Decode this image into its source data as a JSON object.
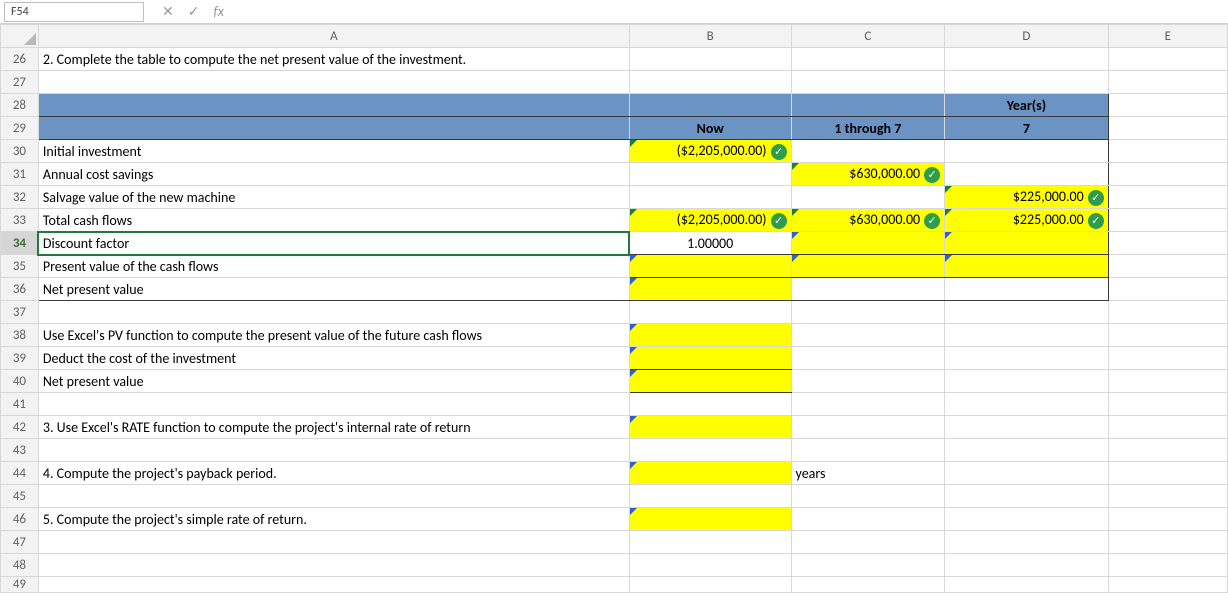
{
  "namebox": "F54",
  "icons": {
    "cancel": "✕",
    "enter": "✓",
    "fx": "fx"
  },
  "cols": {
    "A": "A",
    "B": "B",
    "C": "C",
    "D": "D",
    "E": "E"
  },
  "rows": {
    "r26": "26",
    "r27": "27",
    "r28": "28",
    "r29": "29",
    "r30": "30",
    "r31": "31",
    "r32": "32",
    "r33": "33",
    "r34": "34",
    "r35": "35",
    "r36": "36",
    "r37": "37",
    "r38": "38",
    "r39": "39",
    "r40": "40",
    "r41": "41",
    "r42": "42",
    "r43": "43",
    "r44": "44",
    "r45": "45",
    "r46": "46",
    "r47": "47",
    "r48": "48",
    "r49": "49"
  },
  "hdr": {
    "years": "Year(s)",
    "now": "Now",
    "oneThrough7": "1 through 7",
    "seven": "7"
  },
  "labels": {
    "q2": "2. Complete the table to compute the net present value of the investment.",
    "initInv": "Initial investment",
    "annSave": "Annual cost savings",
    "salvage": "Salvage value of the new machine",
    "totalCF": "Total cash flows",
    "disc": "Discount factor",
    "pvCF": "Present value of the cash flows",
    "npv": "Net present value",
    "pvFunc": "Use Excel's PV function to compute the present value of the future cash flows",
    "deduct": "Deduct the cost of the investment",
    "npv2": "Net present value",
    "q3": "3. Use Excel's RATE function to compute the project's internal rate of return",
    "q4": "4. Compute the project's payback period.",
    "years": "years",
    "q5": "5. Compute the project's simple rate of return."
  },
  "vals": {
    "B30": "($2,205,000.00)",
    "C31": "$630,000.00",
    "D32": "$225,000.00",
    "B33": "($2,205,000.00)",
    "C33": "$630,000.00",
    "D33": "$225,000.00",
    "B34": "1.00000"
  },
  "chart_data": {
    "type": "table",
    "title": "NPV computation table",
    "columns": [
      "Row label",
      "Now",
      "1 through 7",
      "7"
    ],
    "rows": [
      [
        "Initial investment",
        -2205000.0,
        null,
        null
      ],
      [
        "Annual cost savings",
        null,
        630000.0,
        null
      ],
      [
        "Salvage value of the new machine",
        null,
        null,
        225000.0
      ],
      [
        "Total cash flows",
        -2205000.0,
        630000.0,
        225000.0
      ],
      [
        "Discount factor",
        1.0,
        null,
        null
      ],
      [
        "Present value of the cash flows",
        null,
        null,
        null
      ],
      [
        "Net present value",
        null,
        null,
        null
      ]
    ]
  }
}
